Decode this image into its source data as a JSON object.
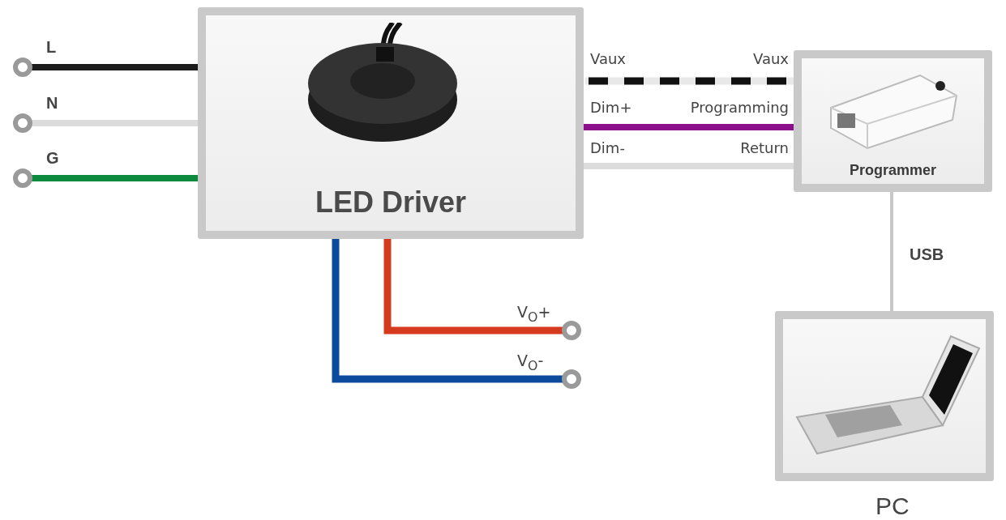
{
  "inputs": [
    {
      "label": "L",
      "color": "#1c1c1c"
    },
    {
      "label": "N",
      "color": "#dcdcdc"
    },
    {
      "label": "G",
      "color": "#0e8a3e"
    }
  ],
  "driver": {
    "title": "LED Driver"
  },
  "signals": [
    {
      "left": "Vaux",
      "right": "Vaux",
      "kind": "striped"
    },
    {
      "left": "Dim+",
      "right": "Programming",
      "kind": "solid",
      "color": "#8c0f8c"
    },
    {
      "left": "Dim-",
      "right": "Return",
      "kind": "solid",
      "color": "#dcdcdc"
    }
  ],
  "programmer": {
    "label": "Programmer"
  },
  "link": {
    "label": "USB"
  },
  "pc": {
    "label": "PC"
  },
  "outputs": [
    {
      "label": "V$_{O}$+",
      "color": "#d63a1e"
    },
    {
      "label": "V$_{O}$-",
      "color": "#0c4a9e"
    }
  ]
}
